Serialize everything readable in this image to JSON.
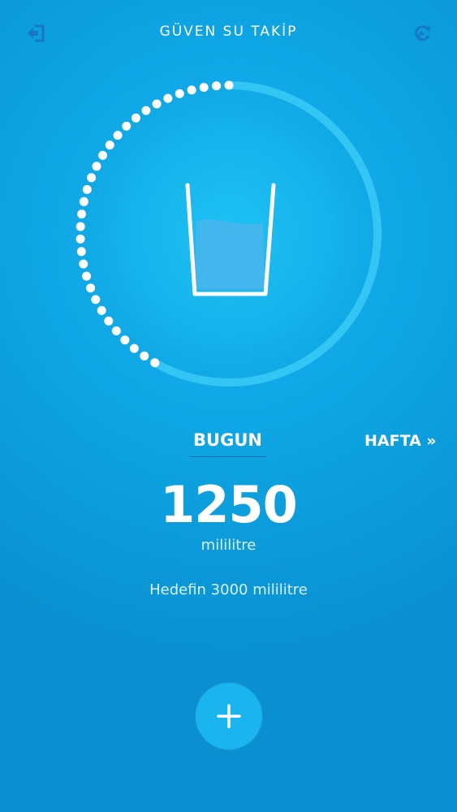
{
  "header": {
    "title": "GÜVEN SU TAKİP",
    "back_icon": "logout-arrow-icon",
    "refresh_icon": "reset-icon"
  },
  "progress": {
    "consumed_ml": 1250,
    "goal_ml": 3000,
    "fraction": 0.417
  },
  "tabs": {
    "today_label": "BUGUN",
    "week_label": "HAFTA »"
  },
  "summary": {
    "amount": "1250",
    "unit": "mililitre",
    "goal_text": "Hedefin 3000 mililitre"
  },
  "actions": {
    "add_icon": "plus-icon"
  },
  "colors": {
    "background": "#0ea6e4",
    "track": "#33c6f5",
    "water": "#43b6ee",
    "button": "#1ab5ef"
  }
}
